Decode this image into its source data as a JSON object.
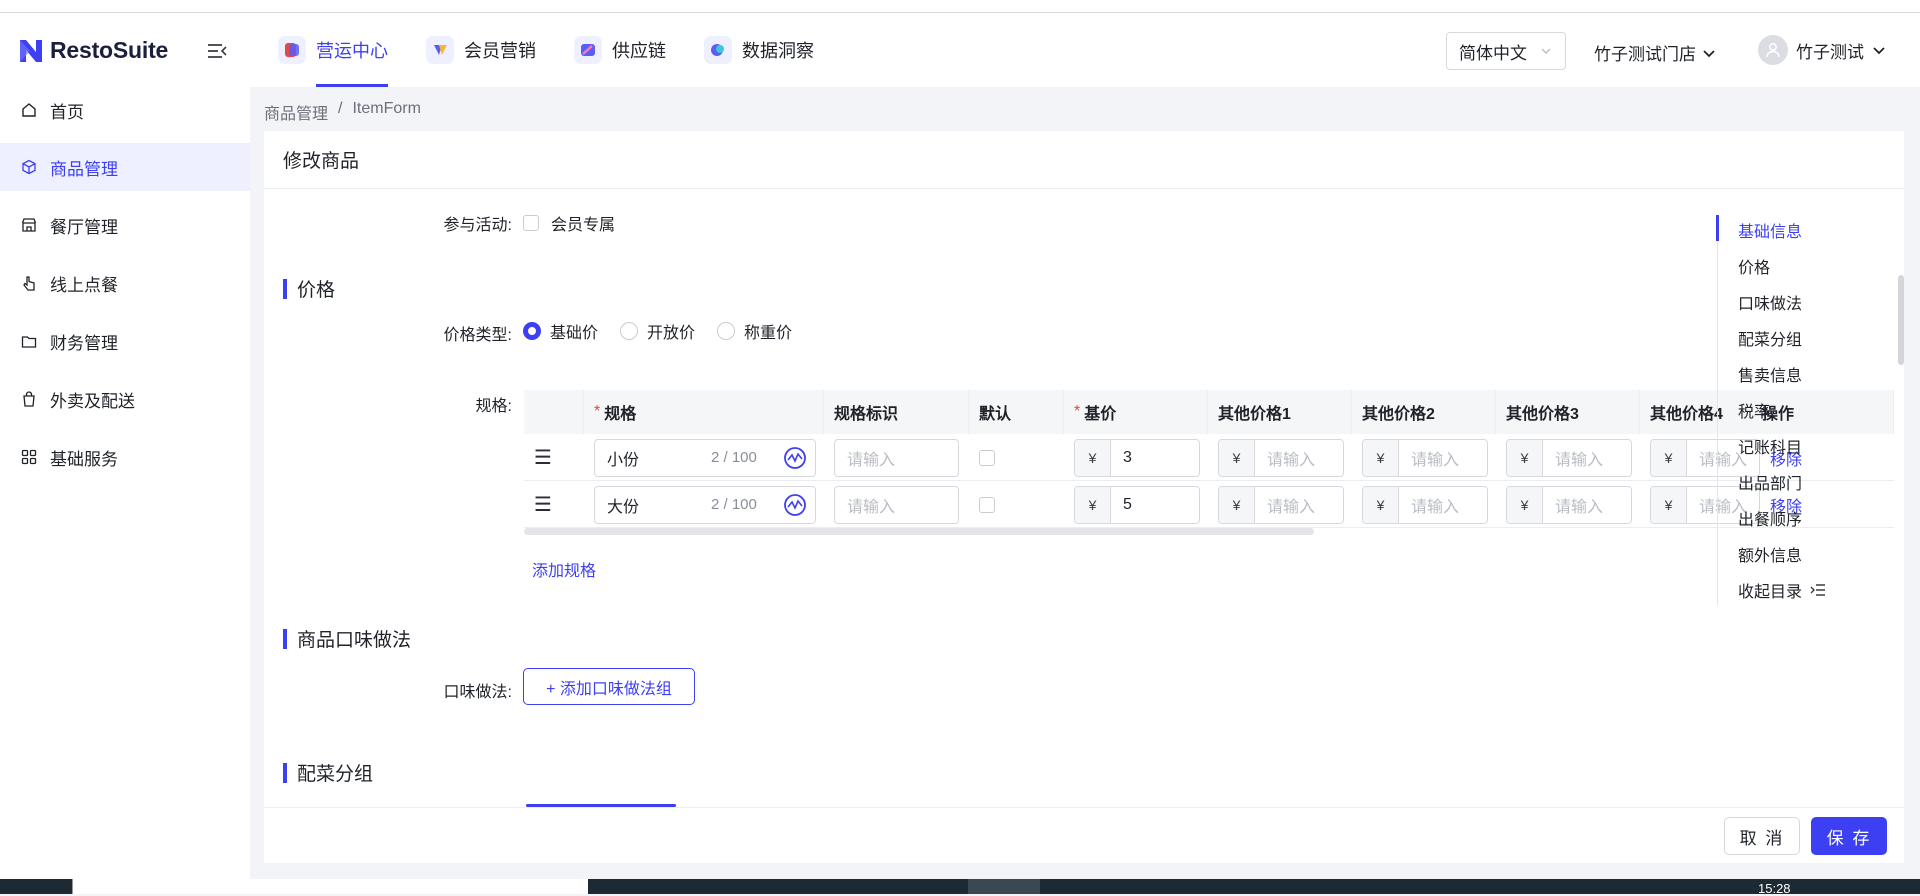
{
  "brand": {
    "name": "RestoSuite",
    "accent": "#3d3ff2"
  },
  "top_nav": [
    {
      "label": "营运中心",
      "active": true,
      "icon": "operations-icon"
    },
    {
      "label": "会员营销",
      "active": false,
      "icon": "membership-icon"
    },
    {
      "label": "供应链",
      "active": false,
      "icon": "supply-chain-icon"
    },
    {
      "label": "数据洞察",
      "active": false,
      "icon": "data-insight-icon"
    }
  ],
  "header_right": {
    "language": "简体中文",
    "store": "竹子测试门店",
    "user": "竹子测试"
  },
  "sidebar": [
    {
      "label": "首页",
      "icon": "home-icon",
      "active": false
    },
    {
      "label": "商品管理",
      "icon": "cube-icon",
      "active": true
    },
    {
      "label": "餐厅管理",
      "icon": "store-icon",
      "active": false
    },
    {
      "label": "线上点餐",
      "icon": "pointer-icon",
      "active": false
    },
    {
      "label": "财务管理",
      "icon": "wallet-icon",
      "active": false
    },
    {
      "label": "外卖及配送",
      "icon": "bag-icon",
      "active": false
    },
    {
      "label": "基础服务",
      "icon": "grid-icon",
      "active": false
    }
  ],
  "breadcrumb": {
    "parent": "商品管理",
    "sep": "/",
    "current": "ItemForm"
  },
  "page_title": "修改商品",
  "activity": {
    "label": "参与活动:",
    "option": "会员专属",
    "checked": false
  },
  "price_section": {
    "title": "价格",
    "type_label": "价格类型:",
    "types": [
      {
        "label": "基础价",
        "selected": true
      },
      {
        "label": "开放价",
        "selected": false
      },
      {
        "label": "称重价",
        "selected": false
      }
    ],
    "spec_label": "规格:",
    "columns": [
      "规格",
      "规格标识",
      "默认",
      "基价",
      "其他价格1",
      "其他价格2",
      "其他价格3",
      "其他价格4",
      "操作"
    ],
    "required_columns": [
      "规格",
      "基价"
    ],
    "rows": [
      {
        "spec": "小份",
        "counter": "2 / 100",
        "identifier": "",
        "default": false,
        "base_price": "3",
        "other1": "",
        "other2": "",
        "other3": "",
        "other4": "",
        "action": "移除"
      },
      {
        "spec": "大份",
        "counter": "2 / 100",
        "identifier": "",
        "default": false,
        "base_price": "5",
        "other1": "",
        "other2": "",
        "other3": "",
        "other4": "",
        "action": "移除"
      }
    ],
    "placeholder": "请输入",
    "currency": "¥",
    "add_spec": "添加规格"
  },
  "flavor_section": {
    "title": "商品口味做法",
    "label": "口味做法:",
    "add_button": "+ 添加口味做法组"
  },
  "combo_section": {
    "title": "配菜分组"
  },
  "toc": {
    "items": [
      "基础信息",
      "价格",
      "口味做法",
      "配菜分组",
      "售卖信息",
      "税率",
      "记账科目",
      "出品部门",
      "出餐顺序",
      "额外信息"
    ],
    "active": "基础信息",
    "collapse_label": "收起目录"
  },
  "footer": {
    "cancel": "取 消",
    "save": "保 存"
  },
  "taskbar": {
    "clock": "15:28"
  }
}
